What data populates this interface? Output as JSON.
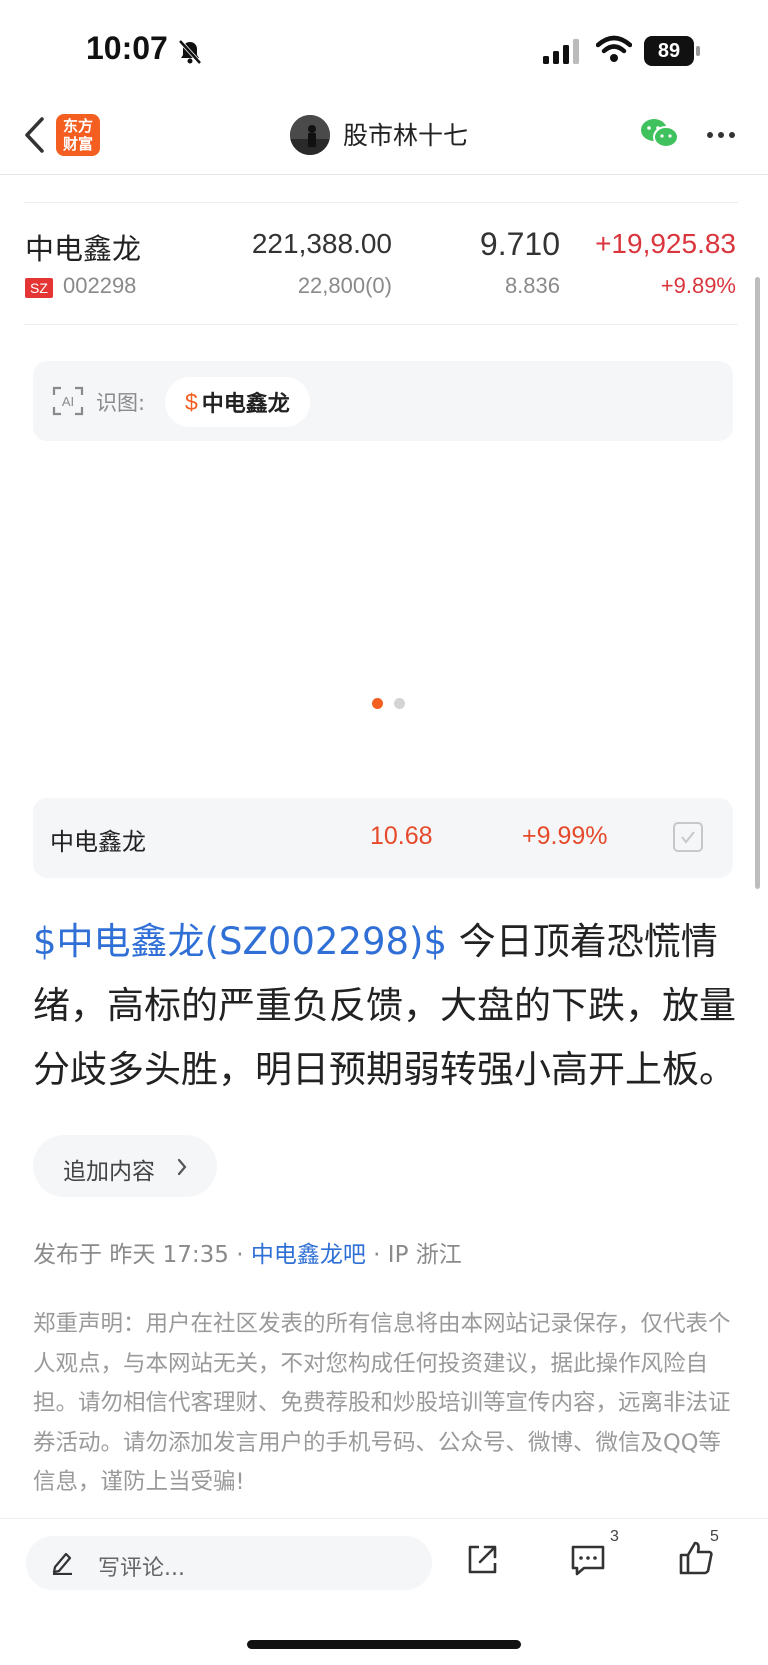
{
  "status_bar": {
    "time": "10:07",
    "battery": "89"
  },
  "nav": {
    "logo_line1": "东方",
    "logo_line2": "财富",
    "author": "股市林十七"
  },
  "quote": {
    "name": "中电鑫龙",
    "exchange": "SZ",
    "code": "002298",
    "amount": "221,388.00",
    "volume": "22,800(0)",
    "price": "9.710",
    "cost": "8.836",
    "change": "+19,925.83",
    "change_pct": "+9.89%"
  },
  "ai_recognize": {
    "label": "识图:",
    "chip_symbol": "$",
    "chip_name": "中电鑫龙"
  },
  "carousel": {
    "total": 2,
    "active": 1
  },
  "stock_card": {
    "name": "中电鑫龙",
    "price": "10.68",
    "change_pct": "+9.99%"
  },
  "post": {
    "tag": "$中电鑫龙(SZ002298)$",
    "text": "  今日顶着恐慌情绪，高标的严重负反馈，大盘的下跌，放量分歧多头胜，明日预期弱转强小高开上板。"
  },
  "add_content": {
    "label": "追加内容"
  },
  "meta": {
    "published_prefix": "发布于",
    "time": "昨天 17:35",
    "sep": "·",
    "bar": "中电鑫龙吧",
    "ip": "IP 浙江"
  },
  "disclaimer": "郑重声明：用户在社区发表的所有信息将由本网站记录保存，仅代表个人观点，与本网站无关，不对您构成任何投资建议，据此操作风险自担。请勿相信代客理财、免费荐股和炒股培训等宣传内容，远离非法证券活动。请勿添加发言用户的手机号码、公众号、微博、微信及QQ等信息，谨防上当受骗!",
  "bottom_bar": {
    "comment_placeholder": "写评论...",
    "comment_count": "3",
    "like_count": "5"
  },
  "colors": {
    "accent_orange": "#f45e20",
    "up_red": "#d9363e",
    "link_blue": "#2f6fd6"
  },
  "icons": [
    "bell-slash-icon",
    "signal-icon",
    "wifi-icon",
    "battery-icon",
    "back-icon",
    "wechat-icon",
    "more-icon",
    "ai-scan-icon",
    "check-icon",
    "chevron-right-icon",
    "pen-icon",
    "share-icon",
    "comment-icon",
    "like-icon"
  ]
}
